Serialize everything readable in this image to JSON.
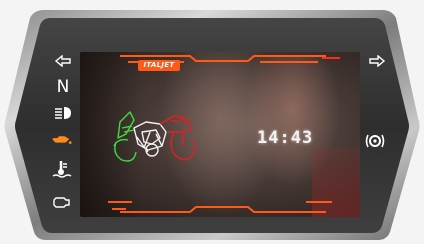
{
  "dashboard": {
    "brand_badge": "ITALJET",
    "time": "14:43",
    "left_indicators": [
      {
        "icon": "turn-left-arrow-icon"
      },
      {
        "icon": "neutral-gear-indicator",
        "label": "N"
      },
      {
        "icon": "headlight-high-beam-icon"
      },
      {
        "icon": "oil-pressure-icon"
      },
      {
        "icon": "coolant-temperature-icon"
      },
      {
        "icon": "engine-check-icon"
      }
    ],
    "right_indicators": [
      {
        "icon": "turn-right-arrow-icon"
      },
      {
        "icon": "abs-brake-warning-icon"
      }
    ],
    "colors": {
      "accent_orange": "#ff5a1a",
      "bike_green": "#3ddc3d",
      "bike_red": "#e02020",
      "bike_white": "#f0f0f0"
    }
  }
}
